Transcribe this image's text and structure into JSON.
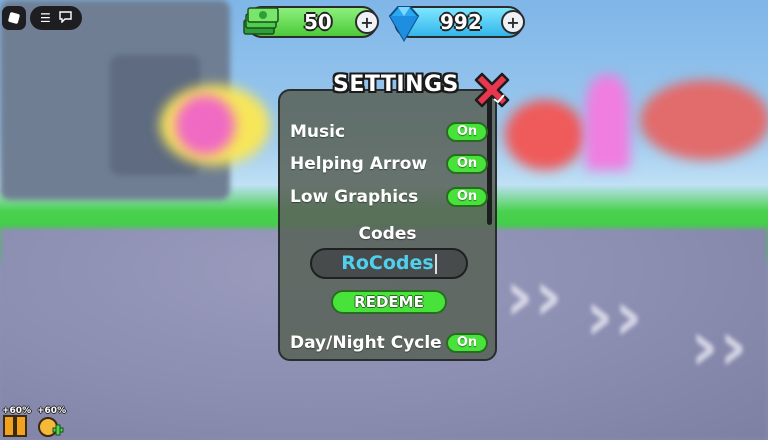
{
  "hud": {
    "money_value": "50",
    "gems_value": "992",
    "plus_symbol": "+",
    "menu_icon": "hamburger-icon",
    "chat_icon": "chat-icon"
  },
  "settings": {
    "title": "SETTINGS",
    "rows": [
      {
        "label": "Music",
        "state": "On"
      },
      {
        "label": "Helping Arrow",
        "state": "On"
      },
      {
        "label": "Low Graphics",
        "state": "On"
      },
      {
        "label": "Day/Night Cycle",
        "state": "On"
      }
    ],
    "codes_label": "Codes",
    "code_input_value": "RoCodes",
    "redeem_label": "REDEME"
  },
  "boosters": [
    {
      "label": "+60%",
      "icon": "doors-booster-icon"
    },
    {
      "label": "+60%",
      "icon": "friend-booster-icon"
    }
  ],
  "colors": {
    "toggle_on": "#47e33a",
    "money_pill": "#4cc93a",
    "gems_pill": "#33b5ea",
    "code_text": "#4fd0ef",
    "close_button": "#e8364f"
  }
}
